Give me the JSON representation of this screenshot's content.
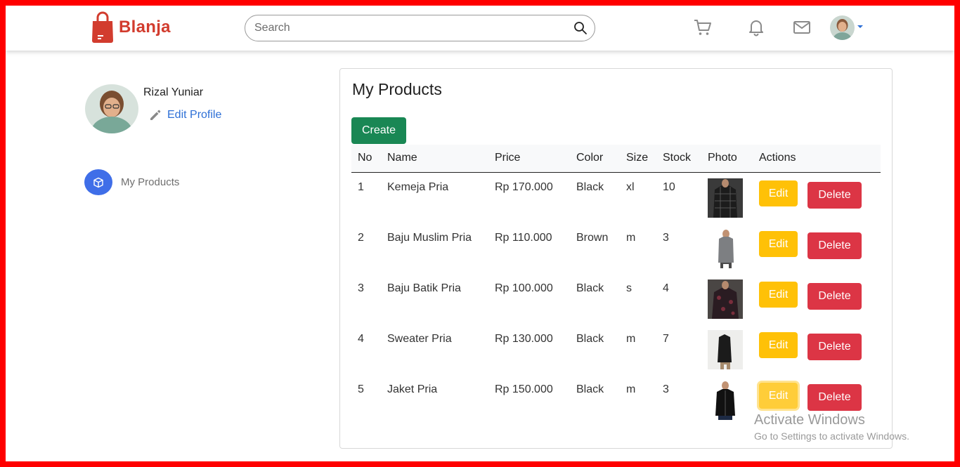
{
  "brand": {
    "name": "Blanja",
    "accent": "#d23c2e"
  },
  "search": {
    "placeholder": "Search",
    "value": ""
  },
  "nav_icons": [
    "cart-icon",
    "bell-icon",
    "mail-icon"
  ],
  "profile": {
    "name": "Rizal Yuniar",
    "edit_label": "Edit Profile"
  },
  "sidebar": {
    "items": [
      {
        "label": "My Products",
        "icon": "box-icon",
        "color": "#3f6ee8"
      }
    ]
  },
  "main": {
    "title": "My Products",
    "create_label": "Create",
    "columns": [
      "No",
      "Name",
      "Price",
      "Color",
      "Size",
      "Stock",
      "Photo",
      "Actions"
    ],
    "edit_label": "Edit",
    "delete_label": "Delete",
    "rows": [
      {
        "no": "1",
        "name": "Kemeja Pria",
        "price": "Rp 170.000",
        "color": "Black",
        "size": "xl",
        "stock": "10"
      },
      {
        "no": "2",
        "name": "Baju Muslim Pria",
        "price": "Rp 110.000",
        "color": "Brown",
        "size": "m",
        "stock": "3"
      },
      {
        "no": "3",
        "name": "Baju Batik Pria",
        "price": "Rp 100.000",
        "color": "Black",
        "size": "s",
        "stock": "4"
      },
      {
        "no": "4",
        "name": "Sweater Pria",
        "price": "Rp 130.000",
        "color": "Black",
        "size": "m",
        "stock": "7"
      },
      {
        "no": "5",
        "name": "Jaket Pria",
        "price": "Rp 150.000",
        "color": "Black",
        "size": "m",
        "stock": "3"
      }
    ]
  },
  "watermark": {
    "title": "Activate Windows",
    "subtitle": "Go to Settings to activate Windows."
  },
  "colors": {
    "create": "#198754",
    "edit": "#ffc107",
    "delete": "#dc3545",
    "link": "#2d6fd6",
    "frame": "#ff0000"
  }
}
